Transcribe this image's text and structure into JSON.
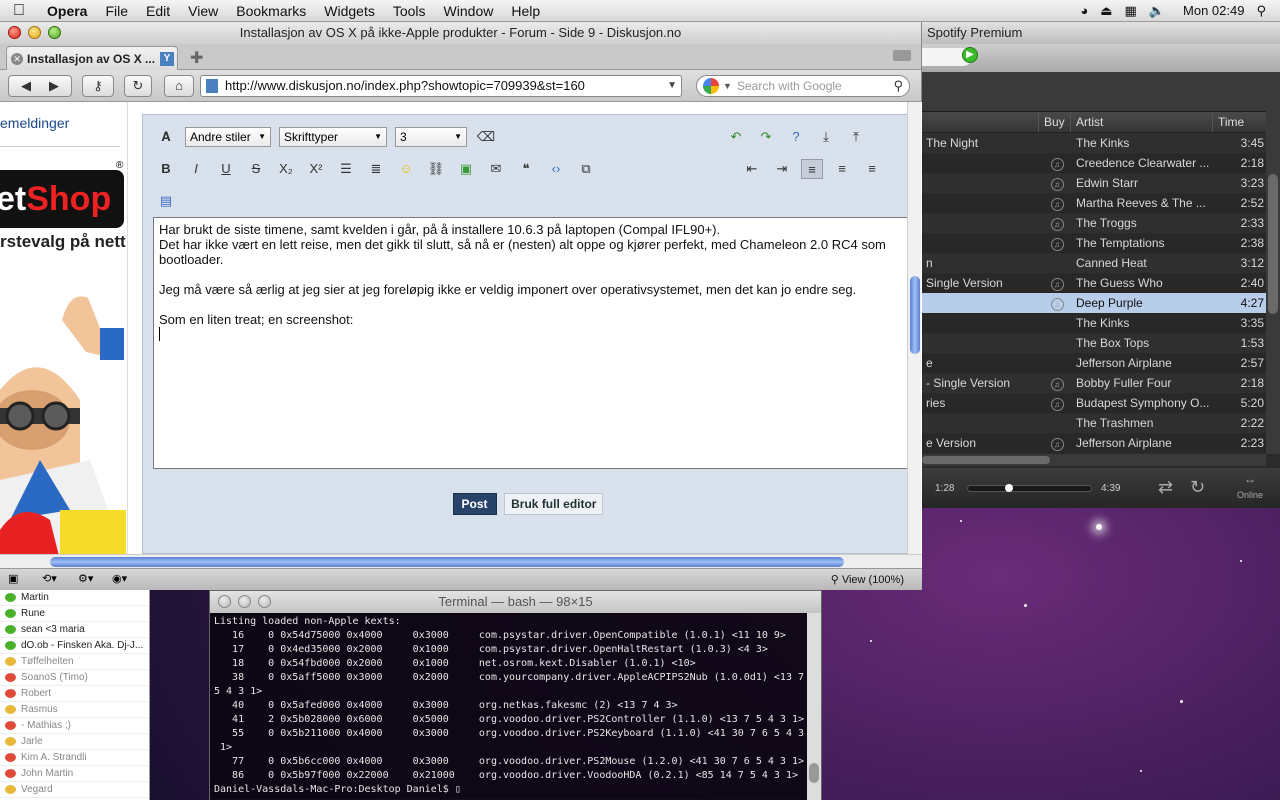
{
  "menubar": {
    "app": "Opera",
    "items": [
      "File",
      "Edit",
      "View",
      "Bookmarks",
      "Widgets",
      "Tools",
      "Window",
      "Help"
    ],
    "clock": "Mon 02:49"
  },
  "spotify": {
    "title": "Spotify Premium",
    "columns": {
      "buy": "Buy",
      "artist": "Artist",
      "time": "Time"
    },
    "rows": [
      {
        "track": "The Night",
        "artist": "The Kinks",
        "time": "3:45",
        "buy": false
      },
      {
        "track": "",
        "artist": "Creedence Clearwater ...",
        "time": "2:18",
        "buy": true
      },
      {
        "track": "",
        "artist": "Edwin Starr",
        "time": "3:23",
        "buy": true
      },
      {
        "track": "",
        "artist": "Martha Reeves & The ...",
        "time": "2:52",
        "buy": true
      },
      {
        "track": "",
        "artist": "The Troggs",
        "time": "2:33",
        "buy": true
      },
      {
        "track": "",
        "artist": "The Temptations",
        "time": "2:38",
        "buy": true
      },
      {
        "track": "n",
        "artist": "Canned Heat",
        "time": "3:12",
        "buy": false
      },
      {
        "track": "Single Version",
        "artist": "The Guess Who",
        "time": "2:40",
        "buy": true
      },
      {
        "track": "",
        "artist": "Deep Purple",
        "time": "4:27",
        "buy": true,
        "selected": true
      },
      {
        "track": "",
        "artist": "The Kinks",
        "time": "3:35",
        "buy": false
      },
      {
        "track": "",
        "artist": "The Box Tops",
        "time": "1:53",
        "buy": false
      },
      {
        "track": "e",
        "artist": "Jefferson Airplane",
        "time": "2:57",
        "buy": false
      },
      {
        "track": "- Single Version",
        "artist": "Bobby Fuller Four",
        "time": "2:18",
        "buy": true
      },
      {
        "track": "ries",
        "artist": "Budapest Symphony O...",
        "time": "5:20",
        "buy": true
      },
      {
        "track": "",
        "artist": "The Trashmen",
        "time": "2:22",
        "buy": false
      },
      {
        "track": "e Version",
        "artist": "Jefferson Airplane",
        "time": "2:23",
        "buy": true
      }
    ],
    "player": {
      "elapsed": "1:28",
      "total": "4:39",
      "status": "Online",
      "progress": 0.32
    }
  },
  "opera": {
    "title": "Installasjon av OS X på ikke-Apple produkter - Forum - Side 9 - Diskusjon.no",
    "tab": "Installasjon av OS X ...",
    "url": "http://www.diskusjon.no/index.php?showtopic=709939&st=160",
    "search_placeholder": "Search with Google",
    "left_link": "emeldinger",
    "ad_shop": "Shop",
    "ad_prefix": "et",
    "ad_tagline": "rstevalg på nett!",
    "editor": {
      "style_select": "Andre stiler",
      "font_select": "Skrifttyper",
      "size_select": "3",
      "lines": [
        "Har brukt de siste timene, samt kvelden i går, på å installere 10.6.3 på laptopen (Compal IFL90+).",
        "Det har ikke vært en lett reise, men det gikk til slutt, så nå er (nesten) alt oppe og kjører perfekt, med Chameleon 2.0 RC4 som bootloader.",
        "Jeg må være så ærlig at jeg sier at jeg foreløpig ikke er veldig imponert over operativsystemet, men det kan jo endre seg.",
        "Som en liten treat; en screenshot:"
      ],
      "post_button": "Post",
      "full_editor_button": "Bruk full editor"
    },
    "zoom": "View (100%)"
  },
  "buddies": [
    {
      "name": "Martin",
      "status": "green"
    },
    {
      "name": "Rune",
      "status": "green"
    },
    {
      "name": "sean  <3  maria",
      "status": "green"
    },
    {
      "name": "dO.ob - Finsken Aka. Dj-J...",
      "status": "green"
    },
    {
      "name": "Tøffelhelten",
      "status": "yellow"
    },
    {
      "name": "SoanoS (Timo)",
      "status": "red"
    },
    {
      "name": "Robert",
      "status": "red"
    },
    {
      "name": "Rasmus",
      "status": "yellow"
    },
    {
      "name": "- Mathias ;)",
      "status": "red"
    },
    {
      "name": "Jarle",
      "status": "yellow"
    },
    {
      "name": "Kim A. Strandli",
      "status": "red"
    },
    {
      "name": "John Martin",
      "status": "red"
    },
    {
      "name": "Vegard",
      "status": "yellow"
    }
  ],
  "terminal": {
    "title": "Terminal — bash — 98×15",
    "lines": [
      "Listing loaded non-Apple kexts:",
      "   16    0 0x54d75000 0x4000     0x3000     com.psystar.driver.OpenCompatible (1.0.1) <11 10 9>",
      "   17    0 0x4ed35000 0x2000     0x1000     com.psystar.driver.OpenHaltRestart (1.0.3) <4 3>",
      "   18    0 0x54fbd000 0x2000     0x1000     net.osrom.kext.Disabler (1.0.1) <10>",
      "   38    0 0x5aff5000 0x3000     0x2000     com.yourcompany.driver.AppleACPIPS2Nub (1.0.0d1) <13 7",
      "5 4 3 1>",
      "   40    0 0x5afed000 0x4000     0x3000     org.netkas.fakesmc (2) <13 7 4 3>",
      "   41    2 0x5b028000 0x6000     0x5000     org.voodoo.driver.PS2Controller (1.1.0) <13 7 5 4 3 1>",
      "   55    0 0x5b211000 0x4000     0x3000     org.voodoo.driver.PS2Keyboard (1.1.0) <41 30 7 6 5 4 3",
      " 1>",
      "   77    0 0x5b6cc000 0x4000     0x3000     org.voodoo.driver.PS2Mouse (1.2.0) <41 30 7 6 5 4 3 1>",
      "   86    0 0x5b97f000 0x22000    0x21000    org.voodoo.driver.VoodooHDA (0.2.1) <85 14 7 5 4 3 1>",
      "Daniel-Vassdals-Mac-Pro:Desktop Daniel$ ▯"
    ]
  },
  "colors": {
    "accent": "#27436a",
    "selection": "#b8cdea",
    "status_green": "#4caf2a",
    "status_yellow": "#e8b93a",
    "status_red": "#e04a3a"
  }
}
